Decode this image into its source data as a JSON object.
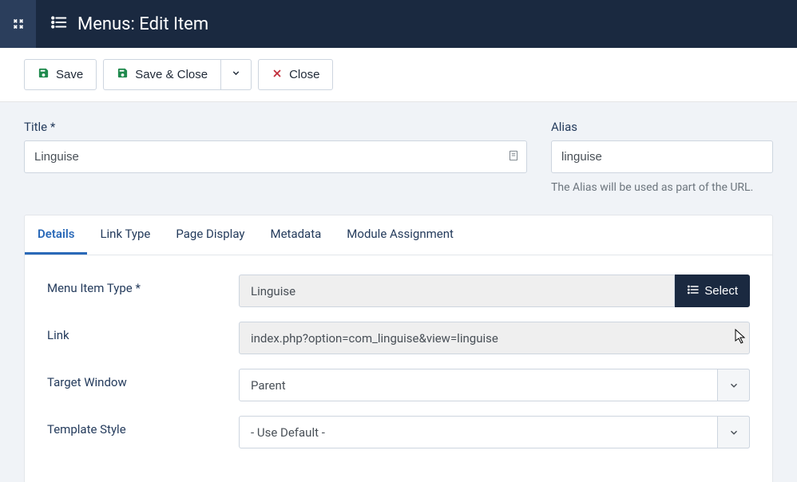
{
  "header": {
    "title": "Menus: Edit Item"
  },
  "toolbar": {
    "save_label": "Save",
    "save_close_label": "Save & Close",
    "close_label": "Close"
  },
  "title_field": {
    "label": "Title *",
    "value": "Linguise"
  },
  "alias_field": {
    "label": "Alias",
    "value": "linguise",
    "help": "The Alias will be used as part of the URL."
  },
  "tabs": [
    {
      "label": "Details",
      "active": true
    },
    {
      "label": "Link Type",
      "active": false
    },
    {
      "label": "Page Display",
      "active": false
    },
    {
      "label": "Metadata",
      "active": false
    },
    {
      "label": "Module Assignment",
      "active": false
    }
  ],
  "details": {
    "menu_item_type": {
      "label": "Menu Item Type *",
      "value": "Linguise",
      "button": "Select"
    },
    "link": {
      "label": "Link",
      "value": "index.php?option=com_linguise&view=linguise"
    },
    "target_window": {
      "label": "Target Window",
      "value": "Parent"
    },
    "template_style": {
      "label": "Template Style",
      "value": "- Use Default -"
    }
  }
}
